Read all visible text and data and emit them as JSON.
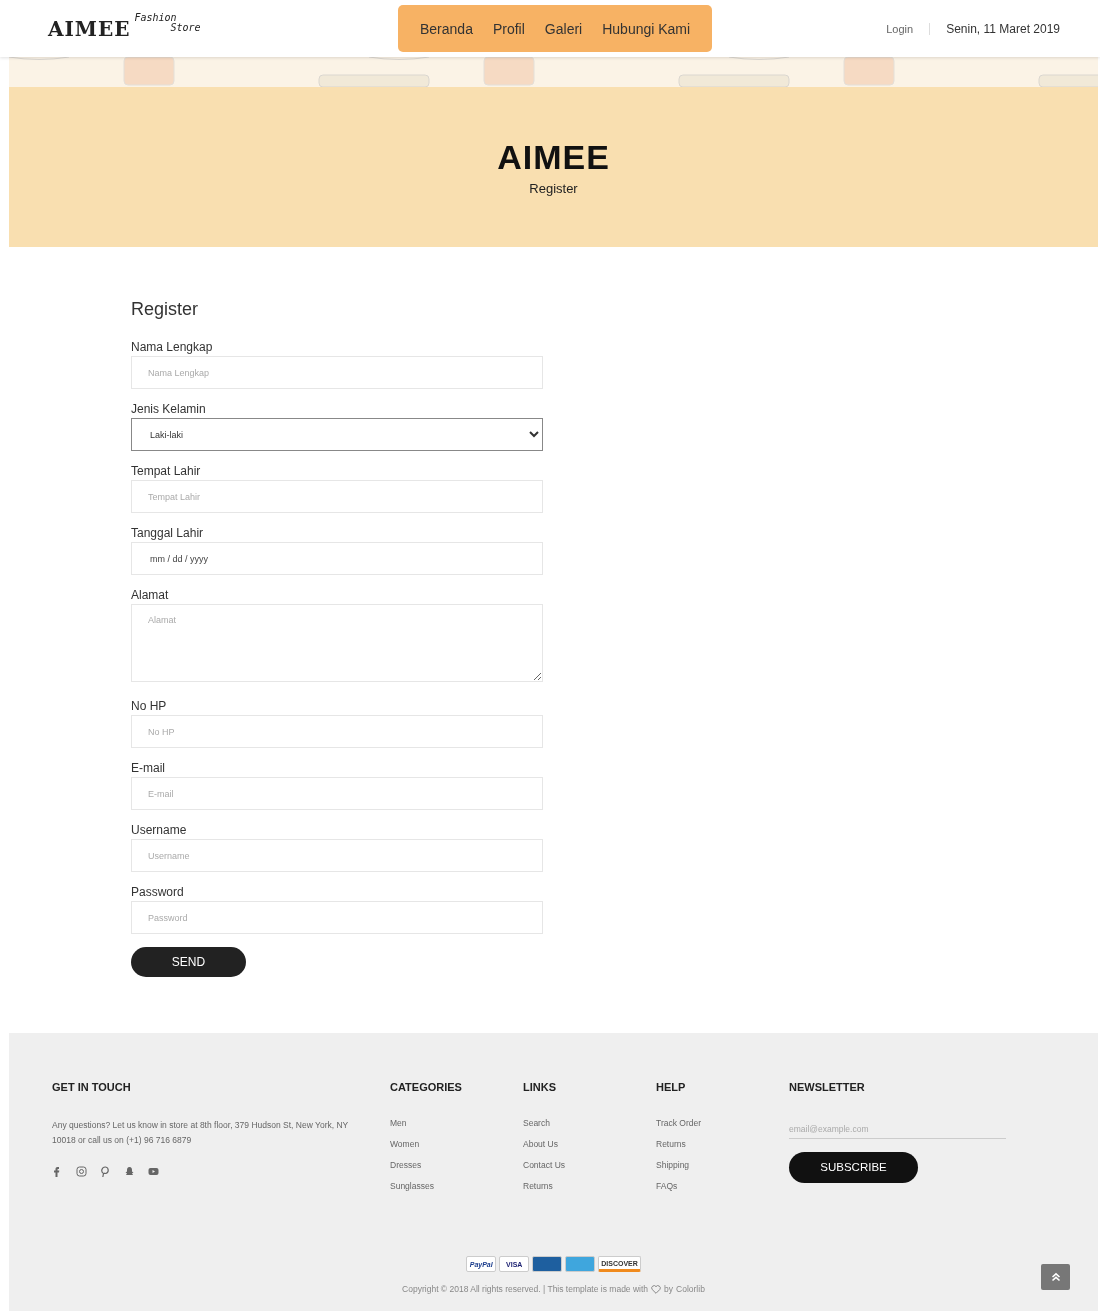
{
  "header": {
    "logo": "AIMEE",
    "logo_tagline_1": "Fashion",
    "logo_tagline_2": "Store",
    "nav": [
      {
        "label": "Beranda"
      },
      {
        "label": "Profil"
      },
      {
        "label": "Galeri"
      },
      {
        "label": "Hubungi Kami"
      }
    ],
    "login": "Login",
    "date": "Senin, 11 Maret 2019"
  },
  "banner": {
    "title": "AIMEE",
    "subtitle": "Register"
  },
  "form": {
    "title": "Register",
    "fields": [
      {
        "label": "Nama Lengkap",
        "kind": "text",
        "placeholder": "Nama Lengkap"
      },
      {
        "label": "Jenis Kelamin",
        "kind": "select",
        "value": "Laki-laki"
      },
      {
        "label": "Tempat Lahir",
        "kind": "text",
        "placeholder": "Tempat Lahir"
      },
      {
        "label": "Tanggal Lahir",
        "kind": "date",
        "placeholder": "mm / dd / yyyy"
      },
      {
        "label": "Alamat",
        "kind": "textarea",
        "placeholder": "Alamat"
      },
      {
        "label": "No HP",
        "kind": "text",
        "placeholder": "No HP"
      },
      {
        "label": "E-mail",
        "kind": "text",
        "placeholder": "E-mail"
      },
      {
        "label": "Username",
        "kind": "text",
        "placeholder": "Username"
      },
      {
        "label": "Password",
        "kind": "password",
        "placeholder": "Password"
      }
    ],
    "submit": "SEND"
  },
  "footer": {
    "contact": {
      "heading": "GET IN TOUCH",
      "text": "Any questions? Let us know in store at 8th floor, 379 Hudson St, New York, NY 10018 or call us on (+1) 96 716 6879",
      "social": [
        {
          "kind": "facebook"
        },
        {
          "kind": "instagram"
        },
        {
          "kind": "pinterest"
        },
        {
          "kind": "snapchat"
        },
        {
          "kind": "youtube"
        }
      ]
    },
    "columns": [
      {
        "heading": "CATEGORIES",
        "links": [
          "Men",
          "Women",
          "Dresses",
          "Sunglasses"
        ]
      },
      {
        "heading": "LINKS",
        "links": [
          "Search",
          "About Us",
          "Contact Us",
          "Returns"
        ]
      },
      {
        "heading": "HELP",
        "links": [
          "Track Order",
          "Returns",
          "Shipping",
          "FAQs"
        ]
      }
    ],
    "newsletter": {
      "heading": "NEWSLETTER",
      "placeholder": "email@example.com",
      "button": "SUBSCRIBE"
    },
    "payments": [
      {
        "kind": "paypal",
        "label": "PayPal"
      },
      {
        "kind": "visa",
        "label": "VISA"
      },
      {
        "kind": "mastercard"
      },
      {
        "kind": "amex"
      },
      {
        "kind": "discover",
        "label": "DISCOVER"
      }
    ],
    "copyright": "Copyright © 2018 All rights reserved. | This template is made with",
    "credit_prefix": "by",
    "credit_link": "Colorlib"
  }
}
